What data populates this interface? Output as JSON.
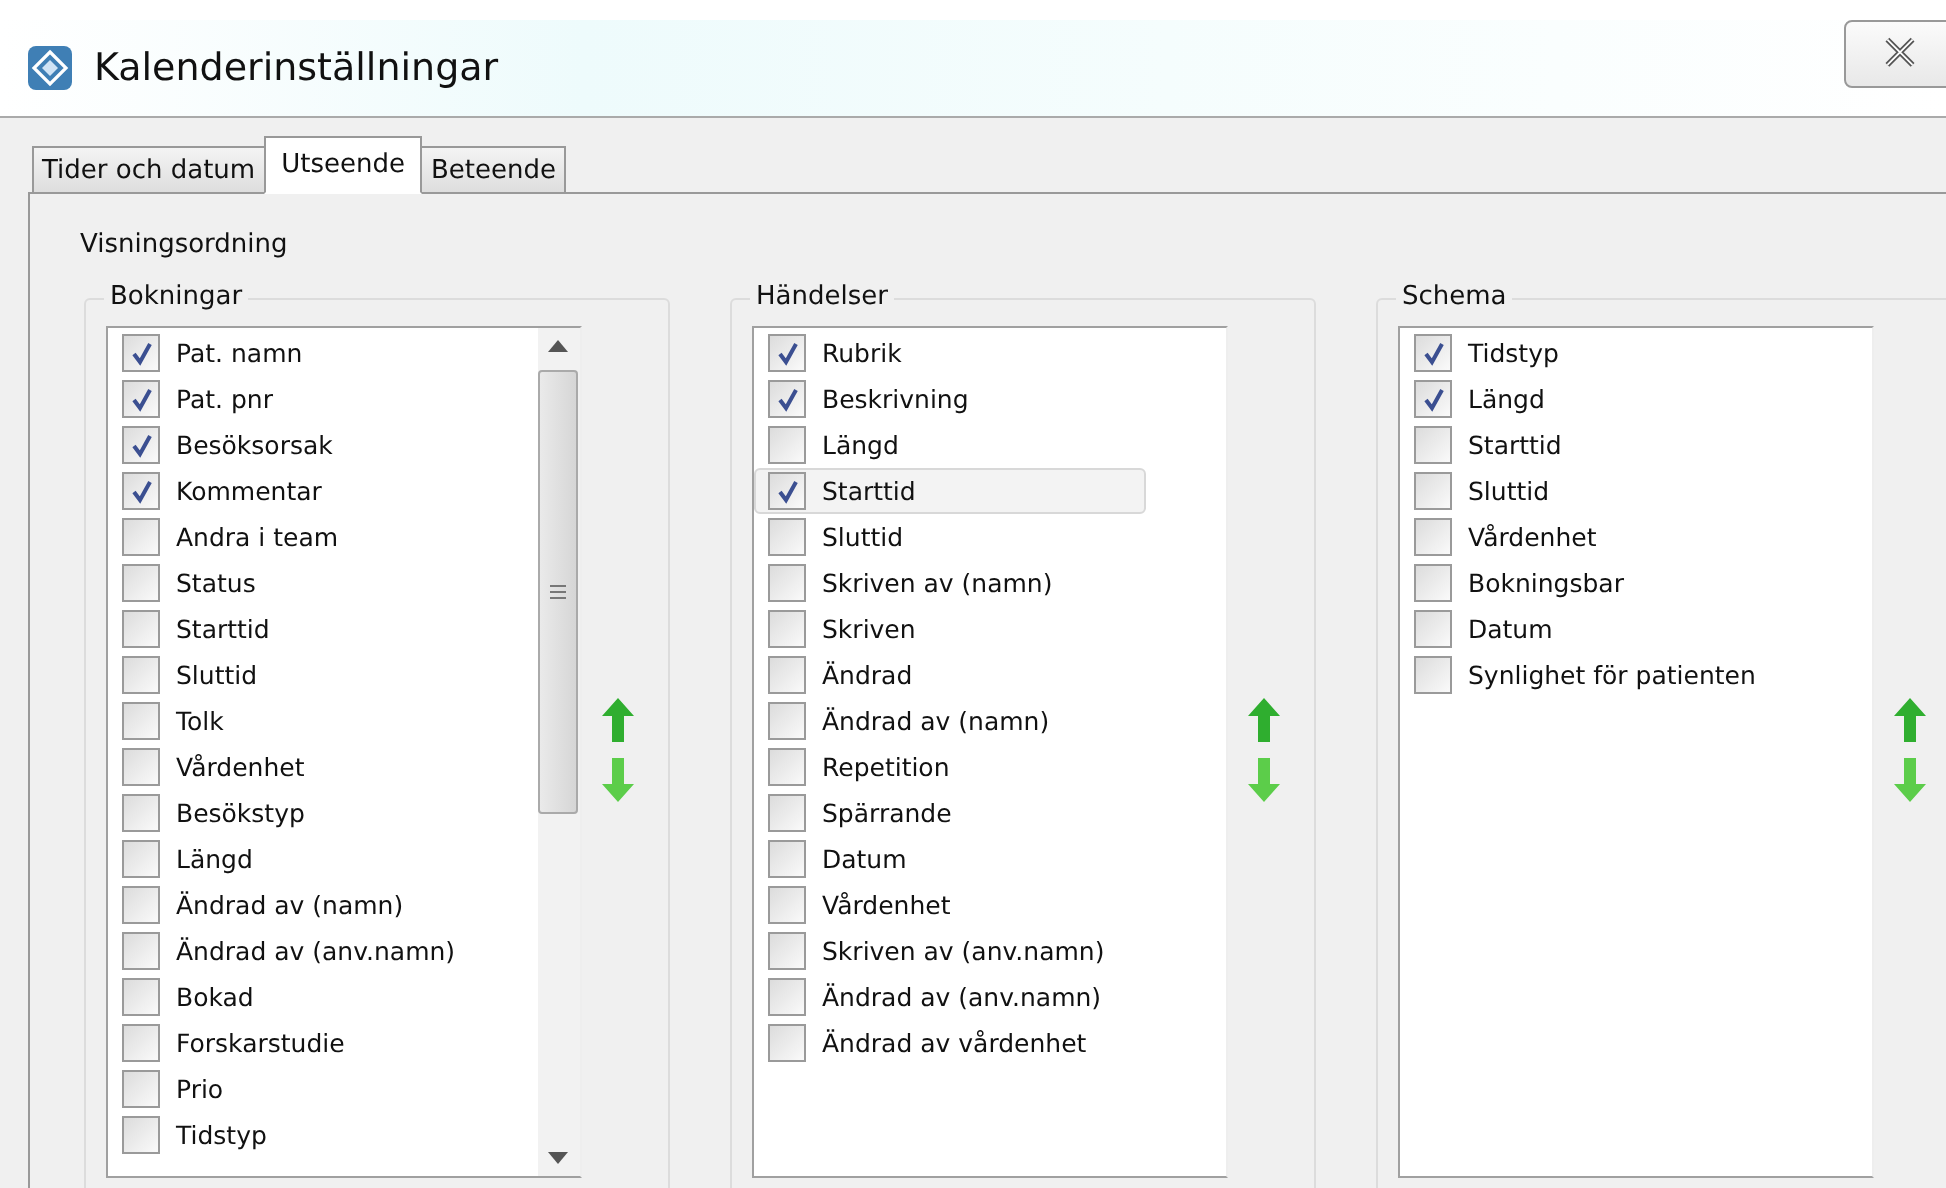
{
  "window": {
    "title": "Kalenderinställningar"
  },
  "tabs": [
    {
      "label": "Tider och datum",
      "selected": false
    },
    {
      "label": "Utseende",
      "selected": true
    },
    {
      "label": "Beteende",
      "selected": false
    }
  ],
  "section_label": "Visningsordning",
  "groups": [
    {
      "title": "Bokningar",
      "scrollable": true,
      "items": [
        {
          "label": "Pat. namn",
          "checked": true,
          "selected": false
        },
        {
          "label": "Pat. pnr",
          "checked": true,
          "selected": false
        },
        {
          "label": "Besöksorsak",
          "checked": true,
          "selected": false
        },
        {
          "label": "Kommentar",
          "checked": true,
          "selected": false
        },
        {
          "label": "Andra i team",
          "checked": false,
          "selected": false
        },
        {
          "label": "Status",
          "checked": false,
          "selected": false
        },
        {
          "label": "Starttid",
          "checked": false,
          "selected": false
        },
        {
          "label": "Sluttid",
          "checked": false,
          "selected": false
        },
        {
          "label": "Tolk",
          "checked": false,
          "selected": false
        },
        {
          "label": "Vårdenhet",
          "checked": false,
          "selected": false
        },
        {
          "label": "Besökstyp",
          "checked": false,
          "selected": false
        },
        {
          "label": "Längd",
          "checked": false,
          "selected": false
        },
        {
          "label": "Ändrad av (namn)",
          "checked": false,
          "selected": false
        },
        {
          "label": "Ändrad av (anv.namn)",
          "checked": false,
          "selected": false
        },
        {
          "label": "Bokad",
          "checked": false,
          "selected": false
        },
        {
          "label": "Forskarstudie",
          "checked": false,
          "selected": false
        },
        {
          "label": "Prio",
          "checked": false,
          "selected": false
        },
        {
          "label": "Tidstyp",
          "checked": false,
          "selected": false
        }
      ]
    },
    {
      "title": "Händelser",
      "scrollable": false,
      "items": [
        {
          "label": "Rubrik",
          "checked": true,
          "selected": false
        },
        {
          "label": "Beskrivning",
          "checked": true,
          "selected": false
        },
        {
          "label": "Längd",
          "checked": false,
          "selected": false
        },
        {
          "label": "Starttid",
          "checked": true,
          "selected": true
        },
        {
          "label": "Sluttid",
          "checked": false,
          "selected": false
        },
        {
          "label": "Skriven av (namn)",
          "checked": false,
          "selected": false
        },
        {
          "label": "Skriven",
          "checked": false,
          "selected": false
        },
        {
          "label": "Ändrad",
          "checked": false,
          "selected": false
        },
        {
          "label": "Ändrad av (namn)",
          "checked": false,
          "selected": false
        },
        {
          "label": "Repetition",
          "checked": false,
          "selected": false
        },
        {
          "label": "Spärrande",
          "checked": false,
          "selected": false
        },
        {
          "label": "Datum",
          "checked": false,
          "selected": false
        },
        {
          "label": "Vårdenhet",
          "checked": false,
          "selected": false
        },
        {
          "label": "Skriven av (anv.namn)",
          "checked": false,
          "selected": false
        },
        {
          "label": "Ändrad av (anv.namn)",
          "checked": false,
          "selected": false
        },
        {
          "label": "Ändrad av vårdenhet",
          "checked": false,
          "selected": false
        }
      ]
    },
    {
      "title": "Schema",
      "scrollable": false,
      "items": [
        {
          "label": "Tidstyp",
          "checked": true,
          "selected": false
        },
        {
          "label": "Längd",
          "checked": true,
          "selected": false
        },
        {
          "label": "Starttid",
          "checked": false,
          "selected": false
        },
        {
          "label": "Sluttid",
          "checked": false,
          "selected": false
        },
        {
          "label": "Vårdenhet",
          "checked": false,
          "selected": false
        },
        {
          "label": "Bokningsbar",
          "checked": false,
          "selected": false
        },
        {
          "label": "Datum",
          "checked": false,
          "selected": false
        },
        {
          "label": "Synlighet för patienten",
          "checked": false,
          "selected": false
        }
      ]
    }
  ]
}
